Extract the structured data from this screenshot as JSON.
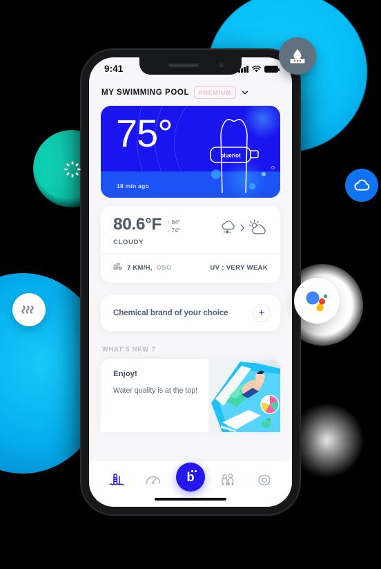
{
  "statusbar": {
    "time": "9:41",
    "signal_icon": "cellular-signal-icon",
    "wifi_icon": "wifi-icon",
    "battery_icon": "battery-icon"
  },
  "header": {
    "title": "MY SWIMMING POOL",
    "badge": "PREMIUM",
    "chevron_icon": "chevron-down-icon"
  },
  "temperature_card": {
    "value": "75°",
    "timestamp": "18 min ago",
    "device_label": "blueriot",
    "bg_color": "#1a14ef",
    "band_color": "#1d52f5"
  },
  "weather_card": {
    "temperature": "80.6°F",
    "high": "↑ 84°",
    "low": "↓ 74°",
    "condition": "CLOUDY",
    "icon_now": "snow-cloud-icon",
    "icon_arrow": "chevron-right-icon",
    "icon_next": "sun-behind-cloud-icon",
    "wind_icon": "wind-icon",
    "wind_speed": "7 KM/H,",
    "wind_direction": "OSO",
    "uv": "UV : VERY WEAK"
  },
  "chemical_card": {
    "label": "Chemical brand of your choice",
    "add_label": "+"
  },
  "whats_new": {
    "section_title": "WHAT'S NEW ?",
    "heading": "Enjoy!",
    "body": "Water quality is at the top!"
  },
  "bottom_nav": {
    "items": [
      {
        "name": "pool-ladder-icon",
        "active": true
      },
      {
        "name": "gauge-icon",
        "active": false
      },
      {
        "name": "blueriot-logo-icon",
        "active": false
      },
      {
        "name": "people-icon",
        "active": false
      },
      {
        "name": "gear-icon",
        "active": false
      }
    ],
    "fab_letter": "b"
  },
  "floating_badges": [
    {
      "name": "chemical-dispenser-badge",
      "color": "#62717f"
    },
    {
      "name": "sun-spinner-badge",
      "color": "#0dcdb0"
    },
    {
      "name": "cloud-badge",
      "color": "#1173f0"
    },
    {
      "name": "heat-waves-badge",
      "color": "#ffffff"
    },
    {
      "name": "google-assistant-badge",
      "color": "#ffffff"
    }
  ]
}
